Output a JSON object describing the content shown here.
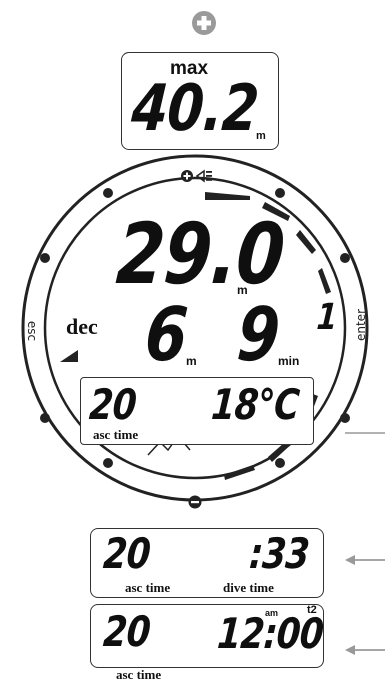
{
  "top_button_symbol": "+",
  "max_panel": {
    "label": "max",
    "value": "40.2",
    "unit": "m"
  },
  "bezel": {
    "top_icons": "+ ◁≡",
    "bottom_icon": "−",
    "left_button_label": "esc",
    "right_button_label": "enter"
  },
  "main_display": {
    "depth_value": "29.0",
    "depth_unit": "m",
    "deco_label": "dec",
    "deco_depth_value": "6",
    "deco_depth_unit": "m",
    "deco_time_value": "9",
    "deco_time_unit": "min",
    "side_digit": "1",
    "inner_panel": {
      "asc_time_value": "20",
      "temperature_value": "18°C",
      "asc_time_label": "asc time"
    }
  },
  "alt_panel_1": {
    "asc_time_value": "20",
    "dive_time_value": ":33",
    "asc_time_label": "asc time",
    "dive_time_label": "dive time"
  },
  "alt_panel_2": {
    "asc_time_value": "20",
    "clock_value": "12:00",
    "am_label": "am",
    "t2_label": "t2",
    "asc_time_label": "asc time"
  },
  "colors": {
    "ink": "#111111",
    "ring": "#222222",
    "arrow": "#999999",
    "background": "#ffffff"
  }
}
